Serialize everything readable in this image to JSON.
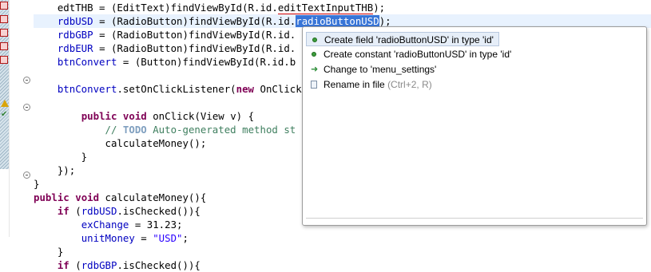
{
  "editor": {
    "lines": [
      {
        "segments": [
          {
            "t": "    edtTHB = (EditText)findViewById(R.id.",
            "c": ""
          },
          {
            "t": "editTextInputTHB",
            "c": "ul"
          },
          {
            "t": ");",
            "c": ""
          }
        ]
      },
      {
        "segments": [
          {
            "t": "    rdbUSD",
            "c": "fld"
          },
          {
            "t": " = (RadioButton)findViewById(R.id.",
            "c": ""
          },
          {
            "t": "radioButtonUSD",
            "c": "sel"
          },
          {
            "t": ");",
            "c": ""
          }
        ],
        "current": true
      },
      {
        "segments": [
          {
            "t": "    rdbGBP",
            "c": "fld"
          },
          {
            "t": " = (RadioButton)findViewById(R.id.",
            "c": ""
          }
        ]
      },
      {
        "segments": [
          {
            "t": "    rdbEUR",
            "c": "fld"
          },
          {
            "t": " = (RadioButton)findViewById(R.id.",
            "c": ""
          }
        ]
      },
      {
        "segments": [
          {
            "t": "    btnConvert",
            "c": "fld"
          },
          {
            "t": " = (Button)findViewById(R.id.b",
            "c": ""
          }
        ]
      },
      {
        "segments": []
      },
      {
        "segments": [
          {
            "t": "    btnConvert",
            "c": "fld"
          },
          {
            "t": ".setOnClickListener(",
            "c": ""
          },
          {
            "t": "new",
            "c": "kw"
          },
          {
            "t": " OnClick",
            "c": ""
          }
        ]
      },
      {
        "segments": []
      },
      {
        "segments": [
          {
            "t": "        ",
            "c": ""
          },
          {
            "t": "public",
            "c": "kw"
          },
          {
            "t": " ",
            "c": ""
          },
          {
            "t": "void",
            "c": "kw"
          },
          {
            "t": " onClick(View v) {",
            "c": ""
          }
        ]
      },
      {
        "segments": [
          {
            "t": "            // ",
            "c": "cmt"
          },
          {
            "t": "TODO",
            "c": "todo"
          },
          {
            "t": " Auto-generated method st",
            "c": "cmt"
          }
        ]
      },
      {
        "segments": [
          {
            "t": "            calculateMoney();",
            "c": ""
          }
        ]
      },
      {
        "segments": [
          {
            "t": "        }",
            "c": ""
          }
        ]
      },
      {
        "segments": [
          {
            "t": "    });",
            "c": ""
          }
        ]
      },
      {
        "segments": [
          {
            "t": "}",
            "c": ""
          }
        ]
      },
      {
        "segments": [
          {
            "t": "public",
            "c": "kw"
          },
          {
            "t": " ",
            "c": ""
          },
          {
            "t": "void",
            "c": "kw"
          },
          {
            "t": " calculateMoney(){",
            "c": ""
          }
        ]
      },
      {
        "segments": [
          {
            "t": "    ",
            "c": ""
          },
          {
            "t": "if",
            "c": "kw"
          },
          {
            "t": " (",
            "c": ""
          },
          {
            "t": "rdbUSD",
            "c": "fld"
          },
          {
            "t": ".isChecked()){",
            "c": ""
          }
        ]
      },
      {
        "segments": [
          {
            "t": "        ",
            "c": ""
          },
          {
            "t": "exChange",
            "c": "fld"
          },
          {
            "t": " = 31.23;",
            "c": ""
          }
        ]
      },
      {
        "segments": [
          {
            "t": "        ",
            "c": ""
          },
          {
            "t": "unitMoney",
            "c": "fld"
          },
          {
            "t": " = ",
            "c": ""
          },
          {
            "t": "\"USD\"",
            "c": "str"
          },
          {
            "t": ";",
            "c": ""
          }
        ]
      },
      {
        "segments": [
          {
            "t": "    }",
            "c": ""
          }
        ]
      },
      {
        "segments": [
          {
            "t": "    ",
            "c": ""
          },
          {
            "t": "if",
            "c": "kw"
          },
          {
            "t": " (",
            "c": ""
          },
          {
            "t": "rdbGBP",
            "c": "fld"
          },
          {
            "t": ".isChecked()){",
            "c": ""
          }
        ]
      }
    ]
  },
  "quickfix": {
    "items": [
      {
        "label": "Create field 'radioButtonUSD' in type 'id'",
        "icon": "field-icon",
        "highlighted": true
      },
      {
        "label": "Create constant 'radioButtonUSD' in type 'id'",
        "icon": "field-icon"
      },
      {
        "label": "Change to 'menu_settings'",
        "icon": "change-icon"
      },
      {
        "label": "Rename in file",
        "shortcut": "(Ctrl+2, R)",
        "icon": "rename-icon"
      }
    ]
  }
}
